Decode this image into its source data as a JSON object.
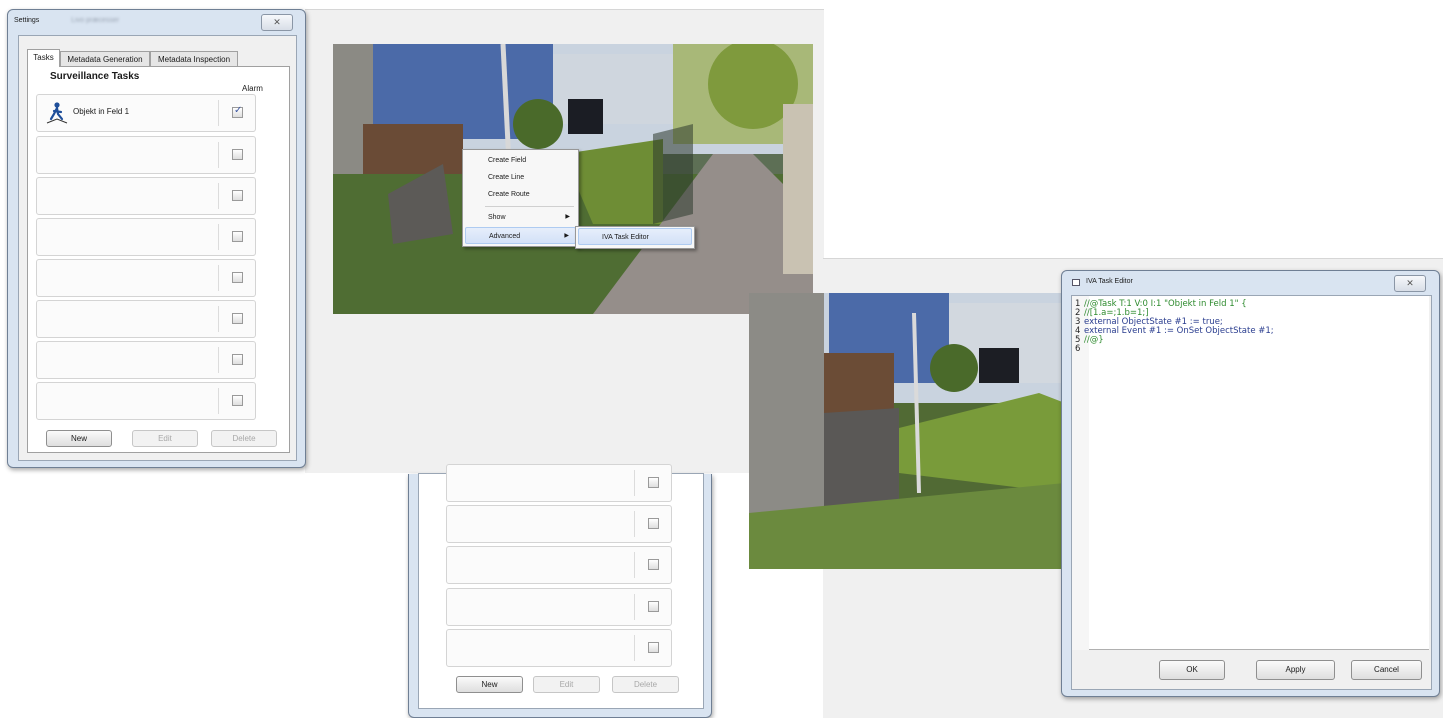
{
  "settings": {
    "title": "Settings",
    "title_blur": "Livo præcesser",
    "close_label": "✕",
    "tabs": [
      {
        "label": "Tasks",
        "active": true
      },
      {
        "label": "Metadata Generation",
        "active": false
      },
      {
        "label": "Metadata Inspection",
        "active": false
      }
    ],
    "header": "Surveillance Tasks",
    "alarm_label": "Alarm",
    "tasks": [
      {
        "label": "Objekt in Feld 1",
        "checked": true
      },
      {
        "label": "",
        "checked": false
      },
      {
        "label": "",
        "checked": false
      },
      {
        "label": "",
        "checked": false
      },
      {
        "label": "",
        "checked": false
      },
      {
        "label": "",
        "checked": false
      },
      {
        "label": "",
        "checked": false
      },
      {
        "label": "",
        "checked": false
      }
    ],
    "buttons": {
      "new": "New",
      "edit": "Edit",
      "delete": "Delete"
    }
  },
  "context_menu": {
    "items": [
      "Create Field",
      "Create Line",
      "Create Route",
      "Show",
      "Advanced"
    ],
    "submenu_item": "IVA Task Editor"
  },
  "lower_panel": {
    "buttons": {
      "new": "New",
      "edit": "Edit",
      "delete": "Delete"
    }
  },
  "editor": {
    "title": "IVA Task Editor",
    "close_label": "✕",
    "lines": [
      {
        "num": "1",
        "text": "//@Task T:1 V:0 I:1 \"Objekt in Feld 1\" {",
        "color": "#2e8b2e"
      },
      {
        "num": "2",
        "text": "//[1.a=;1.b=1;]",
        "color": "#2e8b2e"
      },
      {
        "num": "3",
        "text": "external ObjectState #1 := true;",
        "color": "#2a3d8f"
      },
      {
        "num": "4",
        "text": "external Event #1 := OnSet ObjectState #1;",
        "color": "#2a3d8f"
      },
      {
        "num": "5",
        "text": "//@}",
        "color": "#2e8b2e"
      },
      {
        "num": "6",
        "text": "",
        "color": "#1f1f1f"
      }
    ],
    "buttons": {
      "ok": "OK",
      "apply": "Apply",
      "cancel": "Cancel"
    }
  },
  "icons": {
    "person": "person-walking-icon",
    "submenu": "chevron-right-icon",
    "close": "close-icon"
  }
}
